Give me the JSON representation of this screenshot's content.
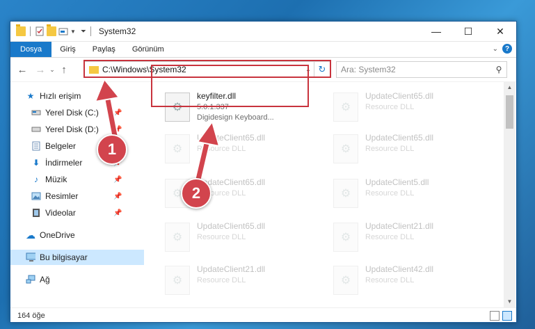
{
  "window": {
    "title": "System32",
    "controls": {
      "minimize": "—",
      "maximize": "☐",
      "close": "✕"
    }
  },
  "ribbon": {
    "tabs": [
      "Dosya",
      "Giriş",
      "Paylaş",
      "Görünüm"
    ],
    "help": "?"
  },
  "address": {
    "path": "C:\\Windows\\System32",
    "search_placeholder": "Ara: System32"
  },
  "nav": {
    "items": [
      {
        "label": "Hızlı erişim",
        "icon": "star-icon",
        "pinned": false
      },
      {
        "label": "Yerel Disk (C:)",
        "icon": "drive-icon",
        "pinned": true
      },
      {
        "label": "Yerel Disk (D:)",
        "icon": "drive-icon",
        "pinned": true
      },
      {
        "label": "Belgeler",
        "icon": "documents-icon",
        "pinned": true
      },
      {
        "label": "İndirmeler",
        "icon": "download-icon",
        "pinned": true
      },
      {
        "label": "Müzik",
        "icon": "music-icon",
        "pinned": true
      },
      {
        "label": "Resimler",
        "icon": "pictures-icon",
        "pinned": true
      },
      {
        "label": "Videolar",
        "icon": "videos-icon",
        "pinned": true
      },
      {
        "label": "OneDrive",
        "icon": "cloud-icon",
        "pinned": false
      },
      {
        "label": "Bu bilgisayar",
        "icon": "computer-icon",
        "pinned": false,
        "selected": true
      },
      {
        "label": "Ağ",
        "icon": "network-icon",
        "pinned": false
      }
    ]
  },
  "files": [
    {
      "name": "keyfilter.dll",
      "line2": "5.0.1.337",
      "line3": "Digidesign Keyboard...",
      "highlight": true
    },
    {
      "name": "UpdateClient65.dll",
      "line2": "Resource DLL"
    },
    {
      "name": "UpdateClient65.dll",
      "line2": "Resource DLL"
    },
    {
      "name": "UpdateClient65.dll",
      "line2": "Resource DLL"
    },
    {
      "name": "UpdateClient65.dll",
      "line2": "Resource DLL"
    },
    {
      "name": "UpdateClient5.dll",
      "line2": "Resource DLL"
    },
    {
      "name": "UpdateClient65.dll",
      "line2": "Resource DLL"
    },
    {
      "name": "UpdateClient21.dll",
      "line2": "Resource DLL"
    },
    {
      "name": "UpdateClient21.dll",
      "line2": "Resource DLL"
    },
    {
      "name": "UpdateClient42.dll",
      "line2": "Resource DLL"
    }
  ],
  "status": {
    "count": "164 öğe"
  },
  "markers": [
    "1",
    "2"
  ],
  "colors": {
    "accent": "#1979ca",
    "highlight": "#c8333d",
    "selected": "#cce8ff"
  }
}
